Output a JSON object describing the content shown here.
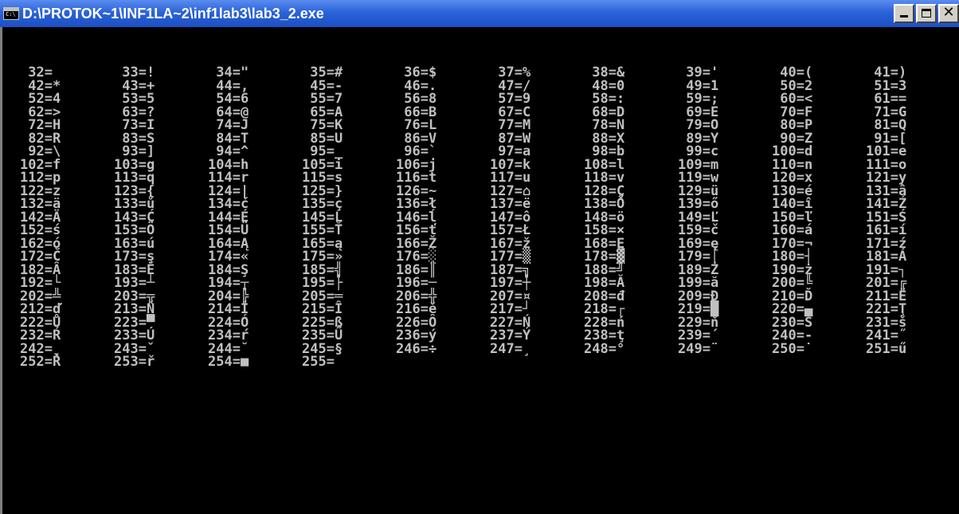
{
  "window": {
    "title": "D:\\PROTOK~1\\INF1LA~2\\inf1lab3\\lab3_2.exe",
    "icon": "console-icon",
    "buttons": {
      "minimize": "minimize-icon",
      "maximize": "maximize-icon",
      "close": "✕"
    }
  },
  "colors": {
    "titlebar": "#2b63d8",
    "console_bg": "#000000",
    "console_fg": "#c0c0c0"
  },
  "console": {
    "rows": [
      [
        " 32=",
        " 33=!",
        " 34=\"",
        " 35=#",
        " 36=$",
        " 37=%",
        " 38=&",
        " 39='",
        " 40=(",
        " 41=)"
      ],
      [
        " 42=*",
        " 43=+",
        " 44=,",
        " 45=-",
        " 46=.",
        " 47=/",
        " 48=0",
        " 49=1",
        " 50=2",
        " 51=3"
      ],
      [
        " 52=4",
        " 53=5",
        " 54=6",
        " 55=7",
        " 56=8",
        " 57=9",
        " 58=:",
        " 59=;",
        " 60=<",
        " 61=="
      ],
      [
        " 62=>",
        " 63=?",
        " 64=@",
        " 65=A",
        " 66=B",
        " 67=C",
        " 68=D",
        " 69=E",
        " 70=F",
        " 71=G"
      ],
      [
        " 72=H",
        " 73=I",
        " 74=J",
        " 75=K",
        " 76=L",
        " 77=M",
        " 78=N",
        " 79=O",
        " 80=P",
        " 81=Q"
      ],
      [
        " 82=R",
        " 83=S",
        " 84=T",
        " 85=U",
        " 86=V",
        " 87=W",
        " 88=X",
        " 89=Y",
        " 90=Z",
        " 91=["
      ],
      [
        " 92=\\",
        " 93=]",
        " 94=^",
        " 95=_",
        " 96=`",
        " 97=a",
        " 98=b",
        " 99=c",
        "100=d",
        "101=e"
      ],
      [
        "102=f",
        "103=g",
        "104=h",
        "105=i",
        "106=j",
        "107=k",
        "108=l",
        "109=m",
        "110=n",
        "111=o"
      ],
      [
        "112=p",
        "113=q",
        "114=r",
        "115=s",
        "116=t",
        "117=u",
        "118=v",
        "119=w",
        "120=x",
        "121=y"
      ],
      [
        "122=z",
        "123={",
        "124=|",
        "125=}",
        "126=~",
        "127=⌂",
        "128=Ç",
        "129=ü",
        "130=é",
        "131=â"
      ],
      [
        "132=ä",
        "133=ů",
        "134=ć",
        "135=ç",
        "136=ł",
        "137=ë",
        "138=Ő",
        "139=ő",
        "140=î",
        "141=Ź"
      ],
      [
        "142=Ä",
        "143=Ć",
        "144=É",
        "145=Ĺ",
        "146=ĺ",
        "147=ô",
        "148=ö",
        "149=Ľ",
        "150=ľ",
        "151=Ś"
      ],
      [
        "152=ś",
        "153=Ö",
        "154=Ü",
        "155=Ť",
        "156=ť",
        "157=Ł",
        "158=×",
        "159=č",
        "160=á",
        "161=í"
      ],
      [
        "162=ó",
        "163=ú",
        "164=Ą",
        "165=ą",
        "166=Ž",
        "167=ž",
        "168=Ę",
        "169=ę",
        "170=¬",
        "171=ź"
      ],
      [
        "172=Č",
        "173=ş",
        "174=«",
        "175=»",
        "176=░",
        "177=▒",
        "178=▓",
        "179=│",
        "180=┤",
        "181=Á"
      ],
      [
        "182=Â",
        "183=Ě",
        "184=Ş",
        "185=╣",
        "186=║",
        "187=╗",
        "188=╝",
        "189=Ż",
        "190=ż",
        "191=┐"
      ],
      [
        "192=└",
        "193=┴",
        "194=┬",
        "195=├",
        "196=─",
        "197=┼",
        "198=Ă",
        "199=ă",
        "200=╚",
        "201=╔"
      ],
      [
        "202=╩",
        "203=╦",
        "204=╠",
        "205=═",
        "206=╬",
        "207=¤",
        "208=đ",
        "209=Đ",
        "210=Ď",
        "211=Ë"
      ],
      [
        "212=ď",
        "213=Ň",
        "214=Í",
        "215=Î",
        "216=ě",
        "217=┘",
        "218=┌",
        "219=█",
        "220=▄",
        "221=Ţ"
      ],
      [
        "222=Ů",
        "223=▀",
        "224=Ó",
        "225=ß",
        "226=Ô",
        "227=Ń",
        "228=ń",
        "229=ň",
        "230=Š",
        "231=š"
      ],
      [
        "232=Ŕ",
        "233=Ú",
        "234=ŕ",
        "235=Ű",
        "236=ý",
        "237=Ý",
        "238=ţ",
        "239=´",
        "240=-",
        "241=˝"
      ],
      [
        "242=˛",
        "243=ˇ",
        "244=˘",
        "245=§",
        "246=÷",
        "247=¸",
        "248=°",
        "249=¨",
        "250=˙",
        "251=ű"
      ],
      [
        "252=Ř",
        "253=ř",
        "254=■",
        "255= ",
        "",
        "",
        "",
        "",
        "",
        ""
      ]
    ]
  }
}
